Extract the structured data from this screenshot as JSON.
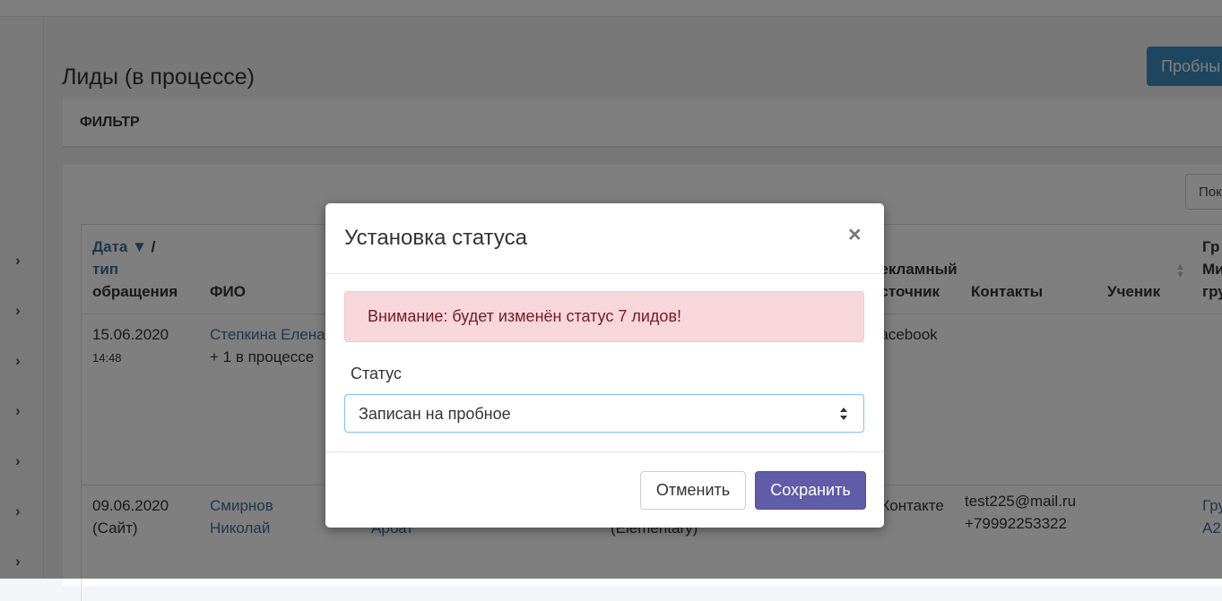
{
  "page": {
    "title": "Лиды (в процессе)",
    "trial_button": "Пробны",
    "filter_title": "ФИЛЬТР",
    "top_right_button": "Пок"
  },
  "table": {
    "headers": {
      "date_line1": "Дата ▼",
      "date_sep": " /",
      "date_line2": "тип",
      "date_line3": "обращения",
      "fio": "ФИО",
      "source_line1": "рекламный",
      "source_line2": "источник",
      "contacts": "Контакты",
      "student": "Ученик",
      "group_line1": "Гр",
      "group_line2": "Ми",
      "group_line3": "гру"
    },
    "rows": [
      {
        "date": "15.06.2020",
        "time": "14:48",
        "fio": "Степкина Елена",
        "fio_extra": "+ 1 в процессе",
        "source": "Facebook",
        "email": "",
        "phone": ""
      },
      {
        "date": "09.06.2020",
        "type": "(Сайт)",
        "fio_line1": "Смирнов",
        "fio_line2": "Николай",
        "extra1": "Арбат",
        "extra2": "(Elementary)",
        "source": "ВКонтакте",
        "email": "test225@mail.ru",
        "phone": "+79992253322",
        "group_line1": "Гру",
        "group_line2": "A2"
      }
    ]
  },
  "modal": {
    "title": "Установка статуса",
    "close": "×",
    "alert": "Внимание: будет изменён статус 7 лидов!",
    "status_label": "Статус",
    "status_value": "Записан на пробное",
    "cancel": "Отменить",
    "save": "Сохранить"
  }
}
